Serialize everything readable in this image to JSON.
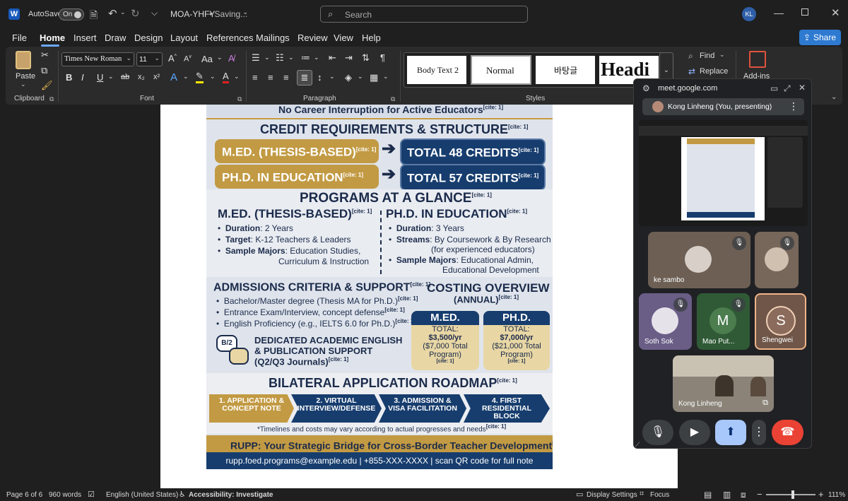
{
  "titlebar": {
    "autosave_label": "AutoSave",
    "autosave_state": "On",
    "doc_title": "MOA-YHFY",
    "save_status": "• Saving...",
    "search_placeholder": "Search",
    "user_initials": "KL"
  },
  "menu": {
    "items": [
      "File",
      "Home",
      "Insert",
      "Draw",
      "Design",
      "Layout",
      "References",
      "Mailings",
      "Review",
      "View",
      "Help"
    ],
    "share_label": "Share"
  },
  "ribbon": {
    "paste_label": "Paste",
    "clipboard_label": "Clipboard",
    "font_name": "Times New Roman",
    "font_size": "11",
    "font_label": "Font",
    "paragraph_label": "Paragraph",
    "styles_label": "Styles",
    "styles": [
      "Body Text 2",
      "Normal",
      "바탕글",
      "Headi"
    ],
    "find_label": "Find",
    "replace_label": "Replace",
    "addins_label": "Add-ins",
    "font_buttons": [
      "B",
      "I",
      "U",
      "ab",
      "x₂",
      "x²"
    ],
    "case_label": "Aa"
  },
  "flyer": {
    "top_line": "No Career Interruption for Active Educators",
    "cite": "[cite: 1]",
    "credit_title": "CREDIT REQUIREMENTS & STRUCTURE",
    "med_thesis": "M.ED. (THESIS-BASED)",
    "total_48": "TOTAL 48 CREDITS",
    "phd_edu": "PH.D. IN EDUCATION",
    "total_57": "TOTAL 57 CREDITS",
    "programs_title": "PROGRAMS AT A GLANCE",
    "med_col_title": "M.ED. (THESIS-BASED)",
    "phd_col_title": "PH.D. IN EDUCATION",
    "med_items": [
      {
        "k": "Duration",
        "v": ": 2 Years"
      },
      {
        "k": "Target",
        "v": ": K-12 Teachers & Leaders"
      },
      {
        "k": "Sample Majors",
        "v": ": Education Studies,"
      }
    ],
    "med_majors_cont": "Curriculum & Instruction",
    "phd_items": [
      {
        "k": "Duration",
        "v": ": 3 Years"
      },
      {
        "k": "Streams",
        "v": ": By Coursework & By Research"
      },
      {
        "k": "Sample Majors",
        "v": ": Educational Admin,"
      }
    ],
    "phd_streams_cont": "(for experienced educators)",
    "phd_majors_cont": "Educational Development",
    "admissions_title": "ADMISSIONS CRITERIA & SUPPORT",
    "admissions_items": [
      "Bachelor/Master degree (Thesis MA for Ph.D.)",
      "Entrance Exam/Interview, concept defense",
      "English Proficiency (e.g., IELTS 6.0 for Ph.D.)"
    ],
    "costing_title": "COSTING OVERVIEW",
    "costing_sub": "(ANNUAL)",
    "cost_med_head": "M.ED.",
    "cost_med_total": "TOTAL:",
    "cost_med_amount": "$3,500/yr",
    "cost_med_prog": "($7,000 Total",
    "cost_med_prog2": "Program)",
    "cost_phd_head": "PH.D.",
    "cost_phd_total": "TOTAL:",
    "cost_phd_amount": "$7,000/yr",
    "cost_phd_prog": "($21,000 Total",
    "cost_phd_prog2": "Program)",
    "b2_badge": "B/2",
    "support_line1": "DEDICATED ACADEMIC ENGLISH",
    "support_line2": "& PUBLICATION SUPPORT",
    "support_line3": "(Q2/Q3 Journals)",
    "roadmap_title": "BILATERAL APPLICATION ROADMAP",
    "roadmap_steps": [
      {
        "l1": "1. APPLICATION &",
        "l2": "CONCEPT NOTE"
      },
      {
        "l1": "2. VIRTUAL",
        "l2": "INTERVIEW/DEFENSE"
      },
      {
        "l1": "3. ADMISSION &",
        "l2": "VISA FACILITATION"
      },
      {
        "l1": "4. FIRST",
        "l2": "RESIDENTIAL",
        "l3": "BLOCK"
      }
    ],
    "timeline_note": "*Timelines and costs may vary according to actual progresses and needs",
    "rupp_banner": "RUPP: Your Strategic Bridge for Cross-Border Teacher Development",
    "contact": "rupp.foed.programs@example.edu | +855-XXX-XXXX | scan QR code for full note"
  },
  "status": {
    "page": "Page 6 of 6",
    "words": "960 words",
    "language": "English (United States)",
    "accessibility": "Accessibility: Investigate",
    "display_settings": "Display Settings",
    "focus": "Focus",
    "zoom": "111%",
    "zoom_level": 0.55
  },
  "meet": {
    "url": "meet.google.com",
    "presenter_label": "Kong Linheng (You, presenting)",
    "participants": [
      {
        "name": "ke sambo"
      },
      {
        "name": ""
      },
      {
        "name": "Soth Sok"
      },
      {
        "name": "Mao Put...",
        "initial": "M"
      },
      {
        "name": "Shengwei",
        "initial": "S"
      },
      {
        "name": "Kong Linheng"
      }
    ]
  },
  "colors": {
    "word_bg": "#1f1f1f",
    "ribbon_bg": "#2b2b2b",
    "share_blue": "#2e7ad1",
    "flyer_navy": "#173d6e",
    "flyer_gold": "#c29a43",
    "meet_bg": "#202124",
    "end_call_red": "#ea4335",
    "present_blue": "#a8c7fa"
  }
}
